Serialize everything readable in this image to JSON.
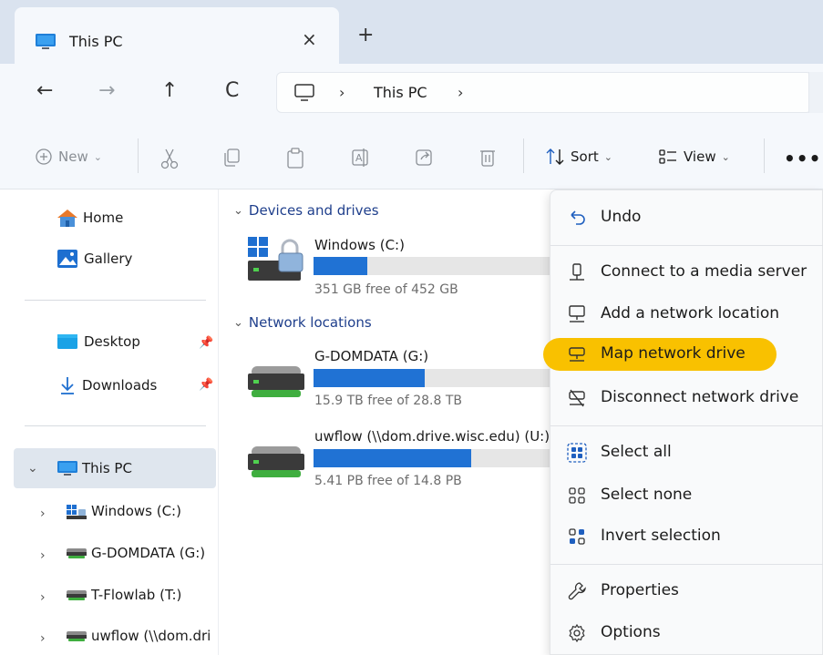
{
  "tab": {
    "title": "This PC",
    "close": "×",
    "new_tab": "+"
  },
  "nav": {
    "back": "←",
    "forward": "→",
    "up": "↑",
    "refresh": "C",
    "chevron": "›",
    "breadcrumb": "This PC"
  },
  "toolbar": {
    "new_label": "New",
    "sort_label": "Sort",
    "view_label": "View",
    "more": "•••",
    "dropdown_caret": "⌄"
  },
  "sidebar": {
    "home": "Home",
    "gallery": "Gallery",
    "desktop": "Desktop",
    "downloads": "Downloads",
    "this_pc": "This PC",
    "drives": [
      "Windows (C:)",
      "G-DOMDATA (G:)",
      "T-Flowlab (T:)",
      "uwflow (\\\\dom.dri"
    ]
  },
  "main": {
    "devices_header": "Devices and drives",
    "network_header": "Network locations",
    "drives": [
      {
        "name": "Windows (C:)",
        "free": "351 GB free of 452 GB",
        "used_fraction": 0.22
      },
      {
        "name": "G-DOMDATA (G:)",
        "free": "15.9 TB free of 28.8 TB",
        "used_fraction": 0.45
      },
      {
        "name": "uwflow (\\\\dom.drive.wisc.edu) (U:)",
        "free": "5.41 PB free of 14.8 PB",
        "used_fraction": 0.64
      }
    ]
  },
  "context_menu": {
    "items": [
      "Undo",
      "Connect to a media server",
      "Add a network location",
      "Map network drive",
      "Disconnect network drive",
      "Select all",
      "Select none",
      "Invert selection",
      "Properties",
      "Options"
    ],
    "highlighted": "Map network drive"
  },
  "colors": {
    "accent": "#2072d4",
    "highlight": "#f9c100",
    "header_blue": "#1f3f8c"
  }
}
